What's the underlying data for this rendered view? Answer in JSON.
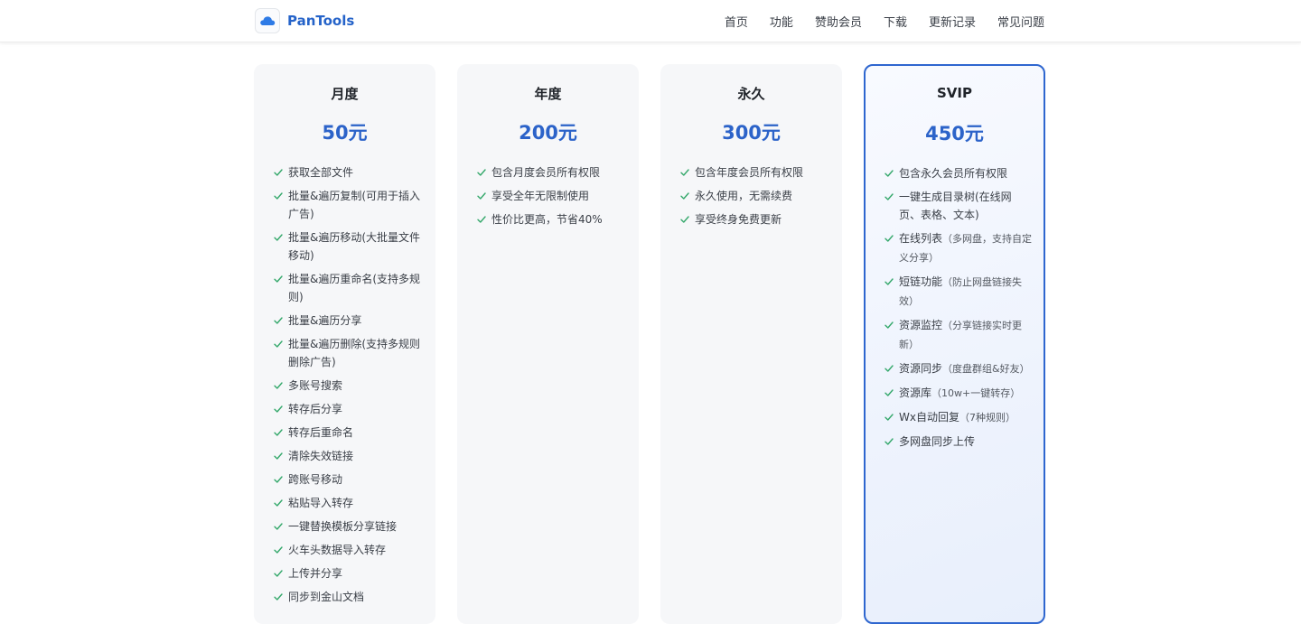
{
  "brand": {
    "name": "PanTools"
  },
  "colors": {
    "accent": "#2c63c9",
    "check": "#34a86b",
    "card_bg": "#f6f7f9"
  },
  "nav": [
    "首页",
    "功能",
    "赞助会员",
    "下载",
    "更新记录",
    "常见问题"
  ],
  "plans": [
    {
      "name": "月度",
      "price": "50元",
      "features": [
        {
          "text": "获取全部文件",
          "note": ""
        },
        {
          "text": "批量&遍历复制(可用于插入广告)",
          "note": ""
        },
        {
          "text": "批量&遍历移动(大批量文件移动)",
          "note": ""
        },
        {
          "text": "批量&遍历重命名(支持多规则)",
          "note": ""
        },
        {
          "text": "批量&遍历分享",
          "note": ""
        },
        {
          "text": "批量&遍历删除(支持多规则删除广告)",
          "note": ""
        },
        {
          "text": "多账号搜索",
          "note": ""
        },
        {
          "text": "转存后分享",
          "note": ""
        },
        {
          "text": "转存后重命名",
          "note": ""
        },
        {
          "text": "清除失效链接",
          "note": ""
        },
        {
          "text": "跨账号移动",
          "note": ""
        },
        {
          "text": "粘贴导入转存",
          "note": ""
        },
        {
          "text": "一键替换模板分享链接",
          "note": ""
        },
        {
          "text": "火车头数据导入转存",
          "note": ""
        },
        {
          "text": "上传并分享",
          "note": ""
        },
        {
          "text": "同步到金山文档",
          "note": ""
        }
      ]
    },
    {
      "name": "年度",
      "price": "200元",
      "features": [
        {
          "text": "包含月度会员所有权限",
          "note": ""
        },
        {
          "text": "享受全年无限制使用",
          "note": ""
        },
        {
          "text": "性价比更高，节省40%",
          "note": ""
        }
      ]
    },
    {
      "name": "永久",
      "price": "300元",
      "features": [
        {
          "text": "包含年度会员所有权限",
          "note": ""
        },
        {
          "text": "永久使用，无需续费",
          "note": ""
        },
        {
          "text": "享受终身免费更新",
          "note": ""
        }
      ]
    },
    {
      "name": "SVIP",
      "price": "450元",
      "features": [
        {
          "text": "包含永久会员所有权限",
          "note": ""
        },
        {
          "text": "一键生成目录树(在线网页、表格、文本)",
          "note": ""
        },
        {
          "text": "在线列表",
          "note": "（多网盘，支持自定义分享）"
        },
        {
          "text": "短链功能",
          "note": "（防止网盘链接失效）"
        },
        {
          "text": "资源监控",
          "note": "（分享链接实时更新）"
        },
        {
          "text": "资源同步",
          "note": "（度盘群组&好友）"
        },
        {
          "text": "资源库",
          "note": "（10w+一键转存）"
        },
        {
          "text": "Wx自动回复",
          "note": "（7种规则）"
        },
        {
          "text": "多网盘同步上传",
          "note": ""
        }
      ]
    }
  ]
}
